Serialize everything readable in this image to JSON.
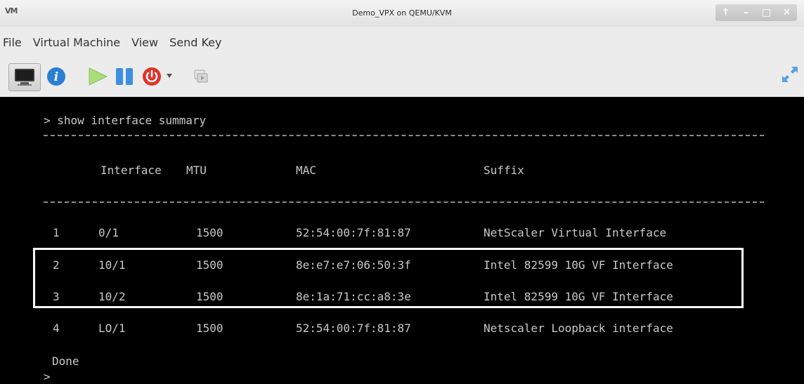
{
  "window": {
    "app_icon": "VM",
    "title": "Demo_VPX on QEMU/KVM",
    "controls": {
      "up": "↑",
      "minimize": "–",
      "maximize": "□",
      "close": "✕"
    }
  },
  "menu": [
    "File",
    "Virtual Machine",
    "View",
    "Send Key"
  ],
  "toolbar": {
    "console_icon": "monitor-icon",
    "info_icon": "info-icon",
    "run_icon": "play-icon",
    "pause_icon": "pause-icon",
    "power_icon": "power-icon",
    "snapshot_icon": "snapshot-icon",
    "fullscreen_icon": "fullscreen-icon"
  },
  "console": {
    "command": "> show interface summary",
    "headers": {
      "index": "",
      "interface": "Interface",
      "mtu": "MTU",
      "mac": "MAC",
      "suffix": "Suffix"
    },
    "rows": [
      {
        "index": "1",
        "interface": "0/1",
        "mtu": "1500",
        "mac": "52:54:00:7f:81:87",
        "suffix": "NetScaler Virtual Interface"
      },
      {
        "index": "2",
        "interface": "10/1",
        "mtu": "1500",
        "mac": "8e:e7:e7:06:50:3f",
        "suffix": "Intel 82599 10G VF Interface"
      },
      {
        "index": "3",
        "interface": "10/2",
        "mtu": "1500",
        "mac": "8e:1a:71:cc:a8:3e",
        "suffix": "Intel 82599 10G VF Interface"
      },
      {
        "index": "4",
        "interface": "LO/1",
        "mtu": "1500",
        "mac": "52:54:00:7f:81:87",
        "suffix": "Netscaler Loopback interface"
      }
    ],
    "done": "Done",
    "prompt": ">"
  },
  "colors": {
    "console_bg": "#000000",
    "console_text": "#c8c8c8",
    "highlight": "#ffffff",
    "power_red": "#e0342a",
    "accent_blue": "#2a7fd4",
    "play_green": "#9bd86a"
  }
}
